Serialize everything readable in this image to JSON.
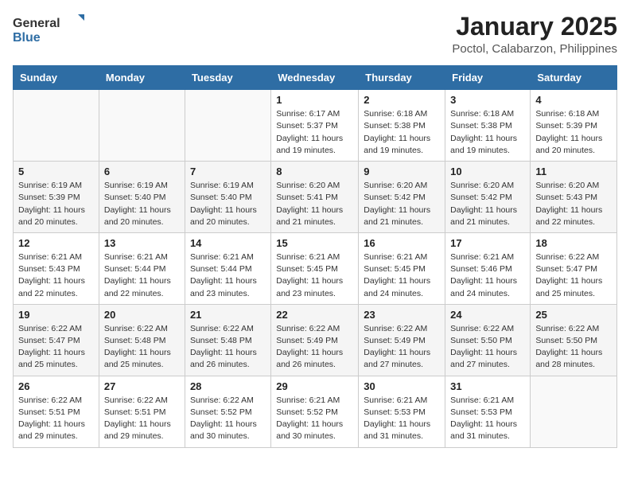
{
  "header": {
    "logo_general": "General",
    "logo_blue": "Blue",
    "title": "January 2025",
    "subtitle": "Poctol, Calabarzon, Philippines"
  },
  "weekdays": [
    "Sunday",
    "Monday",
    "Tuesday",
    "Wednesday",
    "Thursday",
    "Friday",
    "Saturday"
  ],
  "weeks": [
    [
      {
        "day": "",
        "sunrise": "",
        "sunset": "",
        "daylight": ""
      },
      {
        "day": "",
        "sunrise": "",
        "sunset": "",
        "daylight": ""
      },
      {
        "day": "",
        "sunrise": "",
        "sunset": "",
        "daylight": ""
      },
      {
        "day": "1",
        "sunrise": "Sunrise: 6:17 AM",
        "sunset": "Sunset: 5:37 PM",
        "daylight": "Daylight: 11 hours and 19 minutes."
      },
      {
        "day": "2",
        "sunrise": "Sunrise: 6:18 AM",
        "sunset": "Sunset: 5:38 PM",
        "daylight": "Daylight: 11 hours and 19 minutes."
      },
      {
        "day": "3",
        "sunrise": "Sunrise: 6:18 AM",
        "sunset": "Sunset: 5:38 PM",
        "daylight": "Daylight: 11 hours and 19 minutes."
      },
      {
        "day": "4",
        "sunrise": "Sunrise: 6:18 AM",
        "sunset": "Sunset: 5:39 PM",
        "daylight": "Daylight: 11 hours and 20 minutes."
      }
    ],
    [
      {
        "day": "5",
        "sunrise": "Sunrise: 6:19 AM",
        "sunset": "Sunset: 5:39 PM",
        "daylight": "Daylight: 11 hours and 20 minutes."
      },
      {
        "day": "6",
        "sunrise": "Sunrise: 6:19 AM",
        "sunset": "Sunset: 5:40 PM",
        "daylight": "Daylight: 11 hours and 20 minutes."
      },
      {
        "day": "7",
        "sunrise": "Sunrise: 6:19 AM",
        "sunset": "Sunset: 5:40 PM",
        "daylight": "Daylight: 11 hours and 20 minutes."
      },
      {
        "day": "8",
        "sunrise": "Sunrise: 6:20 AM",
        "sunset": "Sunset: 5:41 PM",
        "daylight": "Daylight: 11 hours and 21 minutes."
      },
      {
        "day": "9",
        "sunrise": "Sunrise: 6:20 AM",
        "sunset": "Sunset: 5:42 PM",
        "daylight": "Daylight: 11 hours and 21 minutes."
      },
      {
        "day": "10",
        "sunrise": "Sunrise: 6:20 AM",
        "sunset": "Sunset: 5:42 PM",
        "daylight": "Daylight: 11 hours and 21 minutes."
      },
      {
        "day": "11",
        "sunrise": "Sunrise: 6:20 AM",
        "sunset": "Sunset: 5:43 PM",
        "daylight": "Daylight: 11 hours and 22 minutes."
      }
    ],
    [
      {
        "day": "12",
        "sunrise": "Sunrise: 6:21 AM",
        "sunset": "Sunset: 5:43 PM",
        "daylight": "Daylight: 11 hours and 22 minutes."
      },
      {
        "day": "13",
        "sunrise": "Sunrise: 6:21 AM",
        "sunset": "Sunset: 5:44 PM",
        "daylight": "Daylight: 11 hours and 22 minutes."
      },
      {
        "day": "14",
        "sunrise": "Sunrise: 6:21 AM",
        "sunset": "Sunset: 5:44 PM",
        "daylight": "Daylight: 11 hours and 23 minutes."
      },
      {
        "day": "15",
        "sunrise": "Sunrise: 6:21 AM",
        "sunset": "Sunset: 5:45 PM",
        "daylight": "Daylight: 11 hours and 23 minutes."
      },
      {
        "day": "16",
        "sunrise": "Sunrise: 6:21 AM",
        "sunset": "Sunset: 5:45 PM",
        "daylight": "Daylight: 11 hours and 24 minutes."
      },
      {
        "day": "17",
        "sunrise": "Sunrise: 6:21 AM",
        "sunset": "Sunset: 5:46 PM",
        "daylight": "Daylight: 11 hours and 24 minutes."
      },
      {
        "day": "18",
        "sunrise": "Sunrise: 6:22 AM",
        "sunset": "Sunset: 5:47 PM",
        "daylight": "Daylight: 11 hours and 25 minutes."
      }
    ],
    [
      {
        "day": "19",
        "sunrise": "Sunrise: 6:22 AM",
        "sunset": "Sunset: 5:47 PM",
        "daylight": "Daylight: 11 hours and 25 minutes."
      },
      {
        "day": "20",
        "sunrise": "Sunrise: 6:22 AM",
        "sunset": "Sunset: 5:48 PM",
        "daylight": "Daylight: 11 hours and 25 minutes."
      },
      {
        "day": "21",
        "sunrise": "Sunrise: 6:22 AM",
        "sunset": "Sunset: 5:48 PM",
        "daylight": "Daylight: 11 hours and 26 minutes."
      },
      {
        "day": "22",
        "sunrise": "Sunrise: 6:22 AM",
        "sunset": "Sunset: 5:49 PM",
        "daylight": "Daylight: 11 hours and 26 minutes."
      },
      {
        "day": "23",
        "sunrise": "Sunrise: 6:22 AM",
        "sunset": "Sunset: 5:49 PM",
        "daylight": "Daylight: 11 hours and 27 minutes."
      },
      {
        "day": "24",
        "sunrise": "Sunrise: 6:22 AM",
        "sunset": "Sunset: 5:50 PM",
        "daylight": "Daylight: 11 hours and 27 minutes."
      },
      {
        "day": "25",
        "sunrise": "Sunrise: 6:22 AM",
        "sunset": "Sunset: 5:50 PM",
        "daylight": "Daylight: 11 hours and 28 minutes."
      }
    ],
    [
      {
        "day": "26",
        "sunrise": "Sunrise: 6:22 AM",
        "sunset": "Sunset: 5:51 PM",
        "daylight": "Daylight: 11 hours and 29 minutes."
      },
      {
        "day": "27",
        "sunrise": "Sunrise: 6:22 AM",
        "sunset": "Sunset: 5:51 PM",
        "daylight": "Daylight: 11 hours and 29 minutes."
      },
      {
        "day": "28",
        "sunrise": "Sunrise: 6:22 AM",
        "sunset": "Sunset: 5:52 PM",
        "daylight": "Daylight: 11 hours and 30 minutes."
      },
      {
        "day": "29",
        "sunrise": "Sunrise: 6:21 AM",
        "sunset": "Sunset: 5:52 PM",
        "daylight": "Daylight: 11 hours and 30 minutes."
      },
      {
        "day": "30",
        "sunrise": "Sunrise: 6:21 AM",
        "sunset": "Sunset: 5:53 PM",
        "daylight": "Daylight: 11 hours and 31 minutes."
      },
      {
        "day": "31",
        "sunrise": "Sunrise: 6:21 AM",
        "sunset": "Sunset: 5:53 PM",
        "daylight": "Daylight: 11 hours and 31 minutes."
      },
      {
        "day": "",
        "sunrise": "",
        "sunset": "",
        "daylight": ""
      }
    ]
  ]
}
